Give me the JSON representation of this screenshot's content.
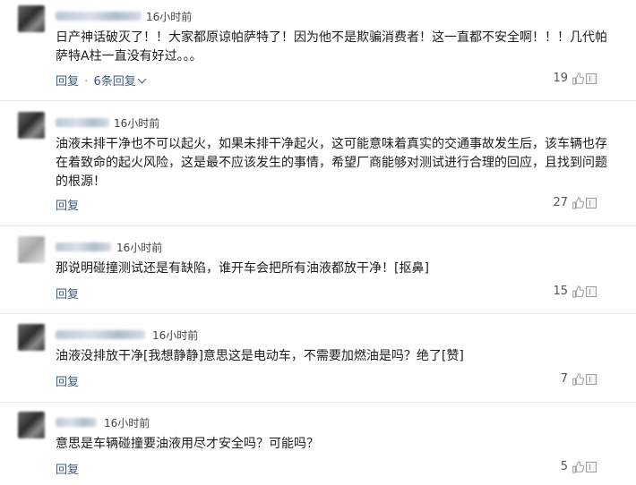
{
  "comments": [
    {
      "time": "16小时前",
      "lines": [
        "日产神话破灭了！！大家都原谅帕萨特了！因为他不是欺骗消费者！这一直都不安全啊！！！几代帕",
        "萨特A柱一直没有好过。。。"
      ],
      "reply_label": "回复",
      "sep": "·",
      "more_replies": "6条回复",
      "likes": "19"
    },
    {
      "time": "16小时前",
      "lines": [
        "油液未排干净也不可以起火，如果未排干净起火，这可能意味着真实的交通事故发生后，该车辆也存",
        "在着致命的起火风险，这是最不应该发生的事情，希望厂商能够对测试进行合理的回应，且找到问题",
        "的根源！"
      ],
      "reply_label": "回复",
      "likes": "27"
    },
    {
      "time": "16小时前",
      "lines": [
        "那说明碰撞测试还是有缺陷，谁开车会把所有油液都放干净！[抠鼻]"
      ],
      "reply_label": "回复",
      "likes": "15"
    },
    {
      "time": "16小时前",
      "lines": [
        "油液没排放干净[我想静静]意思这是电动车，不需要加燃油是吗？绝了[赞]"
      ],
      "reply_label": "回复",
      "likes": "7"
    },
    {
      "time": "16小时前",
      "lines": [
        "意思是车辆碰撞要油液用尽才安全吗？可能吗？"
      ],
      "reply_label": "回复",
      "likes": "5"
    }
  ],
  "icons": {
    "like": "thumbs-up-icon",
    "report": "report-icon",
    "expand": "chevron-down-icon"
  },
  "colors": {
    "link": "#3c5a82",
    "text": "#1c1c1c",
    "meta": "#444444",
    "divider": "#e6e6e6"
  }
}
